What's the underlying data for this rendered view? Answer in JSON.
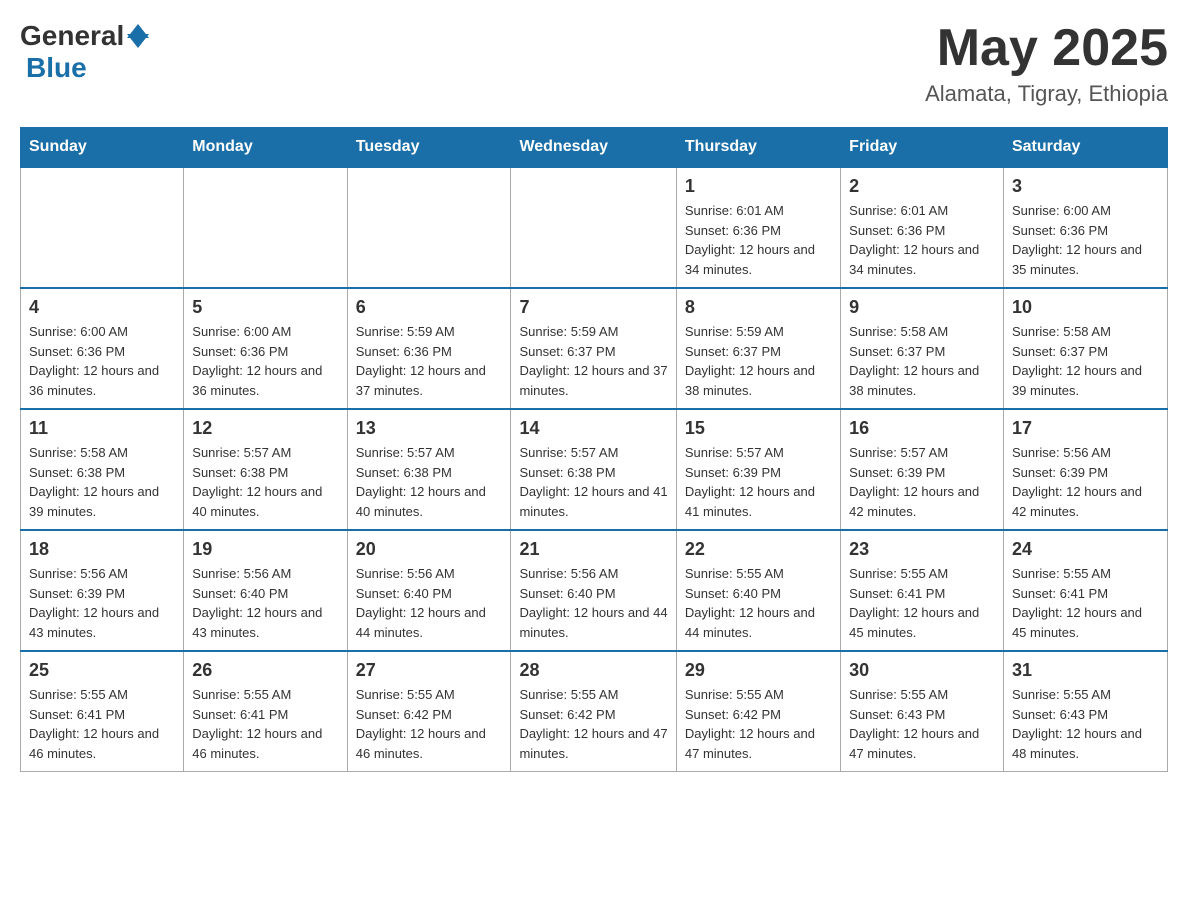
{
  "header": {
    "logo_general": "General",
    "logo_blue": "Blue",
    "month_year": "May 2025",
    "location": "Alamata, Tigray, Ethiopia"
  },
  "days_of_week": [
    "Sunday",
    "Monday",
    "Tuesday",
    "Wednesday",
    "Thursday",
    "Friday",
    "Saturday"
  ],
  "weeks": [
    [
      {
        "day": "",
        "info": ""
      },
      {
        "day": "",
        "info": ""
      },
      {
        "day": "",
        "info": ""
      },
      {
        "day": "",
        "info": ""
      },
      {
        "day": "1",
        "info": "Sunrise: 6:01 AM\nSunset: 6:36 PM\nDaylight: 12 hours and 34 minutes."
      },
      {
        "day": "2",
        "info": "Sunrise: 6:01 AM\nSunset: 6:36 PM\nDaylight: 12 hours and 34 minutes."
      },
      {
        "day": "3",
        "info": "Sunrise: 6:00 AM\nSunset: 6:36 PM\nDaylight: 12 hours and 35 minutes."
      }
    ],
    [
      {
        "day": "4",
        "info": "Sunrise: 6:00 AM\nSunset: 6:36 PM\nDaylight: 12 hours and 36 minutes."
      },
      {
        "day": "5",
        "info": "Sunrise: 6:00 AM\nSunset: 6:36 PM\nDaylight: 12 hours and 36 minutes."
      },
      {
        "day": "6",
        "info": "Sunrise: 5:59 AM\nSunset: 6:36 PM\nDaylight: 12 hours and 37 minutes."
      },
      {
        "day": "7",
        "info": "Sunrise: 5:59 AM\nSunset: 6:37 PM\nDaylight: 12 hours and 37 minutes."
      },
      {
        "day": "8",
        "info": "Sunrise: 5:59 AM\nSunset: 6:37 PM\nDaylight: 12 hours and 38 minutes."
      },
      {
        "day": "9",
        "info": "Sunrise: 5:58 AM\nSunset: 6:37 PM\nDaylight: 12 hours and 38 minutes."
      },
      {
        "day": "10",
        "info": "Sunrise: 5:58 AM\nSunset: 6:37 PM\nDaylight: 12 hours and 39 minutes."
      }
    ],
    [
      {
        "day": "11",
        "info": "Sunrise: 5:58 AM\nSunset: 6:38 PM\nDaylight: 12 hours and 39 minutes."
      },
      {
        "day": "12",
        "info": "Sunrise: 5:57 AM\nSunset: 6:38 PM\nDaylight: 12 hours and 40 minutes."
      },
      {
        "day": "13",
        "info": "Sunrise: 5:57 AM\nSunset: 6:38 PM\nDaylight: 12 hours and 40 minutes."
      },
      {
        "day": "14",
        "info": "Sunrise: 5:57 AM\nSunset: 6:38 PM\nDaylight: 12 hours and 41 minutes."
      },
      {
        "day": "15",
        "info": "Sunrise: 5:57 AM\nSunset: 6:39 PM\nDaylight: 12 hours and 41 minutes."
      },
      {
        "day": "16",
        "info": "Sunrise: 5:57 AM\nSunset: 6:39 PM\nDaylight: 12 hours and 42 minutes."
      },
      {
        "day": "17",
        "info": "Sunrise: 5:56 AM\nSunset: 6:39 PM\nDaylight: 12 hours and 42 minutes."
      }
    ],
    [
      {
        "day": "18",
        "info": "Sunrise: 5:56 AM\nSunset: 6:39 PM\nDaylight: 12 hours and 43 minutes."
      },
      {
        "day": "19",
        "info": "Sunrise: 5:56 AM\nSunset: 6:40 PM\nDaylight: 12 hours and 43 minutes."
      },
      {
        "day": "20",
        "info": "Sunrise: 5:56 AM\nSunset: 6:40 PM\nDaylight: 12 hours and 44 minutes."
      },
      {
        "day": "21",
        "info": "Sunrise: 5:56 AM\nSunset: 6:40 PM\nDaylight: 12 hours and 44 minutes."
      },
      {
        "day": "22",
        "info": "Sunrise: 5:55 AM\nSunset: 6:40 PM\nDaylight: 12 hours and 44 minutes."
      },
      {
        "day": "23",
        "info": "Sunrise: 5:55 AM\nSunset: 6:41 PM\nDaylight: 12 hours and 45 minutes."
      },
      {
        "day": "24",
        "info": "Sunrise: 5:55 AM\nSunset: 6:41 PM\nDaylight: 12 hours and 45 minutes."
      }
    ],
    [
      {
        "day": "25",
        "info": "Sunrise: 5:55 AM\nSunset: 6:41 PM\nDaylight: 12 hours and 46 minutes."
      },
      {
        "day": "26",
        "info": "Sunrise: 5:55 AM\nSunset: 6:41 PM\nDaylight: 12 hours and 46 minutes."
      },
      {
        "day": "27",
        "info": "Sunrise: 5:55 AM\nSunset: 6:42 PM\nDaylight: 12 hours and 46 minutes."
      },
      {
        "day": "28",
        "info": "Sunrise: 5:55 AM\nSunset: 6:42 PM\nDaylight: 12 hours and 47 minutes."
      },
      {
        "day": "29",
        "info": "Sunrise: 5:55 AM\nSunset: 6:42 PM\nDaylight: 12 hours and 47 minutes."
      },
      {
        "day": "30",
        "info": "Sunrise: 5:55 AM\nSunset: 6:43 PM\nDaylight: 12 hours and 47 minutes."
      },
      {
        "day": "31",
        "info": "Sunrise: 5:55 AM\nSunset: 6:43 PM\nDaylight: 12 hours and 48 minutes."
      }
    ]
  ]
}
